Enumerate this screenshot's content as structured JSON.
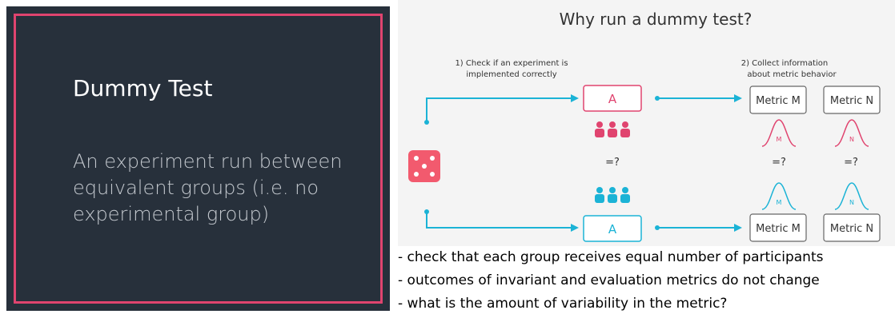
{
  "slide": {
    "title": "Dummy Test",
    "description": "An experiment run between equivalent groups (i.e. no experimental group)"
  },
  "diagram": {
    "title": "Why run a dummy test?",
    "step1": [
      "1) Check if an experiment is",
      "implemented correctly"
    ],
    "step2": [
      "2) Collect information",
      "about metric behavior"
    ],
    "group_label_top": "A",
    "group_label_bottom": "A",
    "metric_m": "Metric M",
    "metric_n": "Metric N",
    "curve_m": "M",
    "curve_n": "N",
    "compare_symbol": "=?",
    "colors": {
      "pink": "#e0446f",
      "blue": "#1bb3d6",
      "dice": "#f25a6e"
    },
    "icons": [
      "dice-icon",
      "people-icon",
      "arrow-icon",
      "bell-curve-icon"
    ]
  },
  "notes": [
    "- check that each group receives equal number of participants",
    "- outcomes of invariant and evaluation metrics do not change",
    "- what is the amount of variability in the metric?"
  ]
}
